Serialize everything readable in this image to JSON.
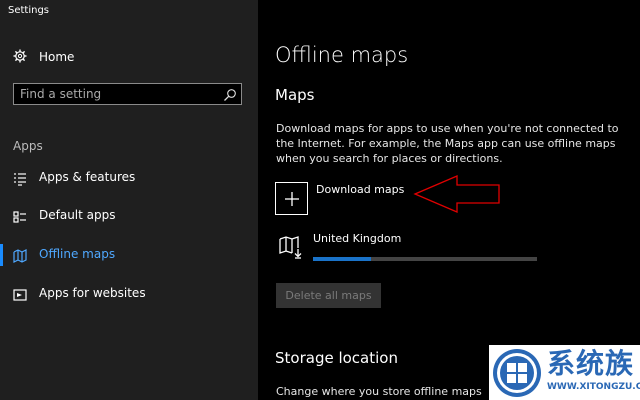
{
  "window": {
    "title": "Settings"
  },
  "sidebar": {
    "home_label": "Home",
    "search_placeholder": "Find a setting",
    "section_label": "Apps",
    "items": [
      {
        "label": "Apps & features",
        "icon": "list-icon"
      },
      {
        "label": "Default apps",
        "icon": "default-apps-icon"
      },
      {
        "label": "Offline maps",
        "icon": "offline-maps-icon",
        "selected": true
      },
      {
        "label": "Apps for websites",
        "icon": "web-app-icon"
      }
    ]
  },
  "main": {
    "title": "Offline maps",
    "maps_heading": "Maps",
    "maps_description": "Download maps for apps to use when you're not connected to the Internet. For example, the Maps app can use offline maps when you search for places or directions.",
    "download_label": "Download maps",
    "downloaded_map": {
      "name": "United Kingdom",
      "progress": 0.26
    },
    "delete_all_label": "Delete all maps",
    "storage_heading": "Storage location",
    "storage_description": "Change where you store offline maps"
  },
  "watermark": {
    "text": "系统族",
    "url": "WWW.XITONGZU.COM"
  },
  "colors": {
    "accent": "#1a8cff",
    "annotation": "#e00000",
    "background": "#000000",
    "sidebar": "#1f1f1f"
  }
}
